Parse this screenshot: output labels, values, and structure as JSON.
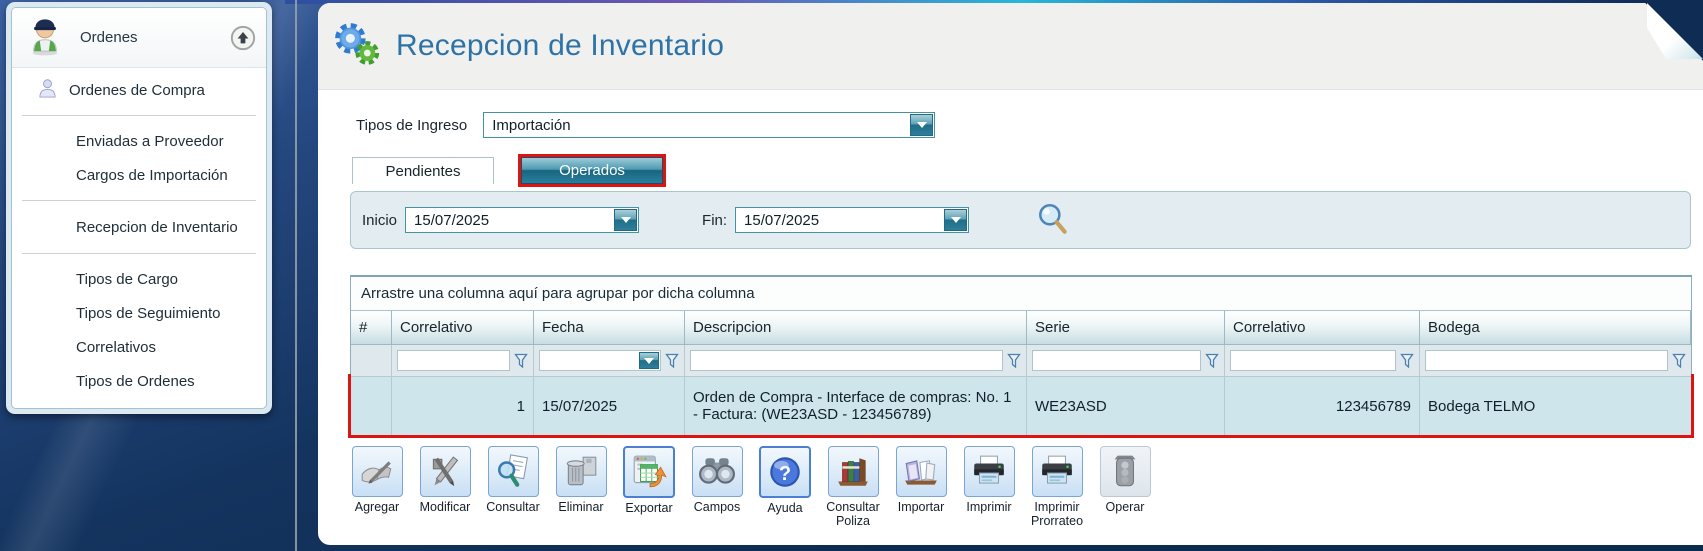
{
  "sidebar": {
    "title": "Ordenes",
    "items": [
      {
        "label": "Ordenes de Compra"
      },
      {
        "label": "Enviadas a Proveedor"
      },
      {
        "label": "Cargos de Importación"
      },
      {
        "label": "Recepcion de Inventario"
      },
      {
        "label": "Tipos de Cargo"
      },
      {
        "label": "Tipos de Seguimiento"
      },
      {
        "label": "Correlativos"
      },
      {
        "label": "Tipos de Ordenes"
      }
    ]
  },
  "header": {
    "title": "Recepcion de Inventario"
  },
  "filters": {
    "tipos_label": "Tipos de Ingreso",
    "tipos_value": "Importación",
    "inicio_label": "Inicio",
    "inicio_value": "15/07/2025",
    "fin_label": "Fin:",
    "fin_value": "15/07/2025"
  },
  "tabs": {
    "pendientes": "Pendientes",
    "operados": "Operados"
  },
  "grid": {
    "group_hint": "Arrastre una columna aquí para agrupar por dicha columna",
    "columns": [
      "#",
      "Correlativo",
      "Fecha",
      "Descripcion",
      "Serie",
      "Correlativo",
      "Bodega"
    ],
    "row": {
      "correlativo": "1",
      "fecha": "15/07/2025",
      "descripcion": "Orden de Compra - Interface de compras: No. 1 - Factura: (WE23ASD - 123456789)",
      "serie": "WE23ASD",
      "correlativo2": "123456789",
      "bodega": "Bodega TELMO"
    }
  },
  "toolbar": {
    "buttons": [
      {
        "label": "Agregar"
      },
      {
        "label": "Modificar"
      },
      {
        "label": "Consultar"
      },
      {
        "label": "Eliminar"
      },
      {
        "label": "Exportar"
      },
      {
        "label": "Campos"
      },
      {
        "label": "Ayuda"
      },
      {
        "label": "Consultar Poliza"
      },
      {
        "label": "Importar"
      },
      {
        "label": "Imprimir"
      },
      {
        "label": "Imprimir Prorrateo"
      },
      {
        "label": "Operar"
      }
    ]
  },
  "colors": {
    "annotation_red": "#de1410",
    "accent_teal": "#2e7f9b",
    "title_blue": "#2e73a8",
    "row_highlight": "#cfe5ec"
  }
}
